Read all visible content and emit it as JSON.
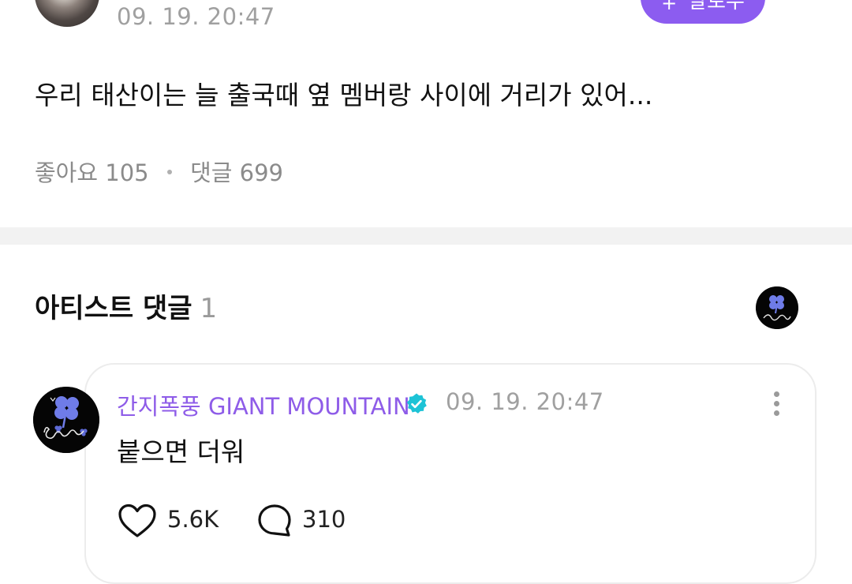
{
  "post": {
    "time": "09. 19. 20:47",
    "follow_label": "팔로우",
    "follow_icon": "plus-icon",
    "body": "우리 태산이는 늘 출국때 옆 멤버랑 사이에 거리가 있어...",
    "likes_label": "좋아요",
    "likes_count": "105",
    "comments_label": "댓글",
    "comments_count": "699"
  },
  "artist_comments": {
    "title": "아티스트 댓글",
    "count": "1"
  },
  "comment": {
    "author": "간지폭풍 GIANT MOUNTAIN",
    "verified_icon": "verified-badge-icon",
    "time": "09. 19. 20:47",
    "text": "붙으면 더워",
    "like_count": "5.6K",
    "reply_count": "310"
  },
  "colors": {
    "accent": "#8c5cf0",
    "author_name": "#8e5ce8",
    "verified": "#1dc3d6",
    "muted_text": "#a0a0a0",
    "divider": "#f2f2f2"
  }
}
